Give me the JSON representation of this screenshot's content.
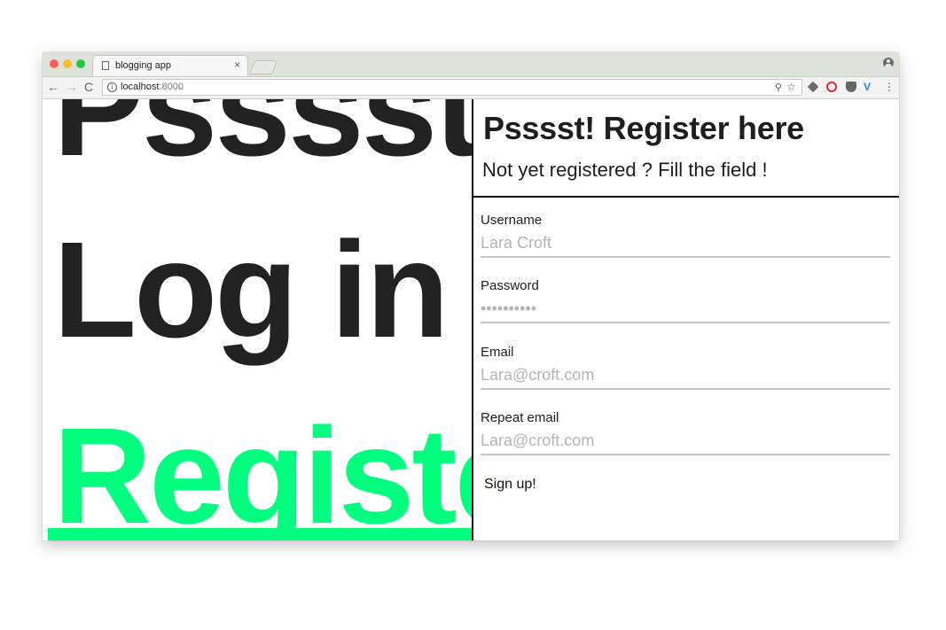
{
  "browser": {
    "tab_title": "blogging app",
    "tab_close": "×",
    "url_host": "localhost",
    "url_port": ":8000",
    "nav_back": "←",
    "nav_forward": "→",
    "nav_reload": "C"
  },
  "background": {
    "heading": "Psssst!",
    "login": "Log in",
    "register": "Register",
    "register_color": "#00ff7f"
  },
  "panel": {
    "title": "Psssst! Register here",
    "subtitle": "Not yet registered ? Fill the field !",
    "fields": [
      {
        "label": "Username",
        "placeholder": "Lara Croft"
      },
      {
        "label": "Password",
        "placeholder": "••••••••••"
      },
      {
        "label": "Email",
        "placeholder": "Lara@croft.com"
      },
      {
        "label": "Repeat email",
        "placeholder": "Lara@croft.com"
      }
    ],
    "submit_label": "Sign up!"
  }
}
